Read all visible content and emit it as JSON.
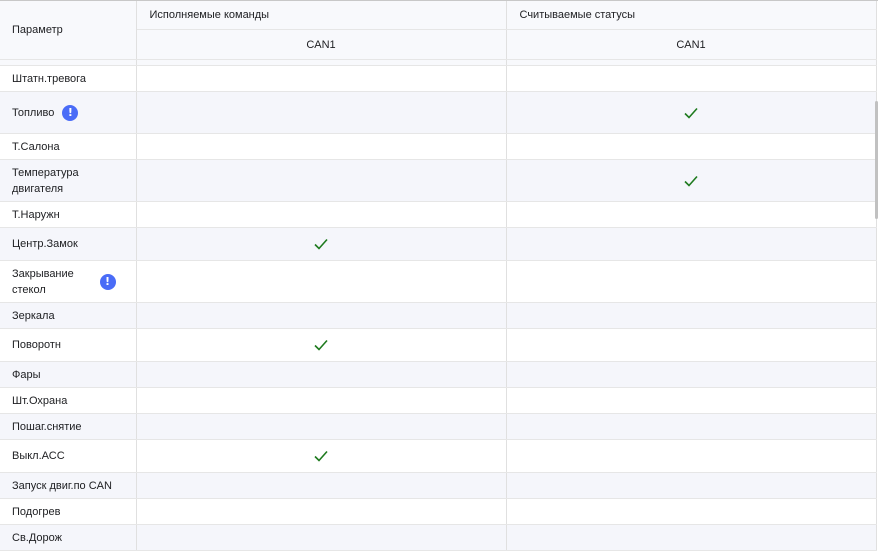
{
  "header": {
    "param_label": "Параметр",
    "commands_label": "Исполняемые команды",
    "statuses_label": "Считываемые статусы",
    "commands_sub": "CAN1",
    "statuses_sub": "CAN1"
  },
  "colors": {
    "check": "#1e7a1e",
    "info_badge": "#4a6cf7",
    "row_alt": "#f5f6fb"
  },
  "rows": [
    {
      "label": "Штатн.тревога",
      "info": false,
      "cmd": false,
      "status": false,
      "height": 26
    },
    {
      "label": "Топливо",
      "info": true,
      "info_inline": true,
      "cmd": false,
      "status": true,
      "height": 42
    },
    {
      "label": "Т.Салона",
      "info": false,
      "cmd": false,
      "status": false,
      "height": 26
    },
    {
      "label": "Температура двигателя",
      "info": false,
      "cmd": false,
      "status": true,
      "height": 42
    },
    {
      "label": "Т.Наружн",
      "info": false,
      "cmd": false,
      "status": false,
      "height": 26
    },
    {
      "label": "Центр.Замок",
      "info": false,
      "cmd": true,
      "status": false,
      "height": 33
    },
    {
      "label": "Закрывание стекол",
      "info": true,
      "info_inline": false,
      "cmd": false,
      "status": false,
      "height": 42
    },
    {
      "label": "Зеркала",
      "info": false,
      "cmd": false,
      "status": false,
      "height": 26
    },
    {
      "label": "Поворотн",
      "info": false,
      "cmd": true,
      "status": false,
      "height": 33
    },
    {
      "label": "Фары",
      "info": false,
      "cmd": false,
      "status": false,
      "height": 26
    },
    {
      "label": "Шт.Охрана",
      "info": false,
      "cmd": false,
      "status": false,
      "height": 26
    },
    {
      "label": "Пошаг.снятие",
      "info": false,
      "cmd": false,
      "status": false,
      "height": 26
    },
    {
      "label": "Выкл.АСС",
      "info": false,
      "cmd": true,
      "status": false,
      "height": 33
    },
    {
      "label": "Запуск двиг.по CAN",
      "info": false,
      "cmd": false,
      "status": false,
      "height": 26
    },
    {
      "label": "Подогрев",
      "info": false,
      "cmd": false,
      "status": false,
      "height": 26
    },
    {
      "label": "Св.Дорож",
      "info": false,
      "cmd": false,
      "status": false,
      "height": 26
    }
  ],
  "icons": {
    "check": "check-icon",
    "info": "info-icon",
    "info_glyph": "!"
  }
}
